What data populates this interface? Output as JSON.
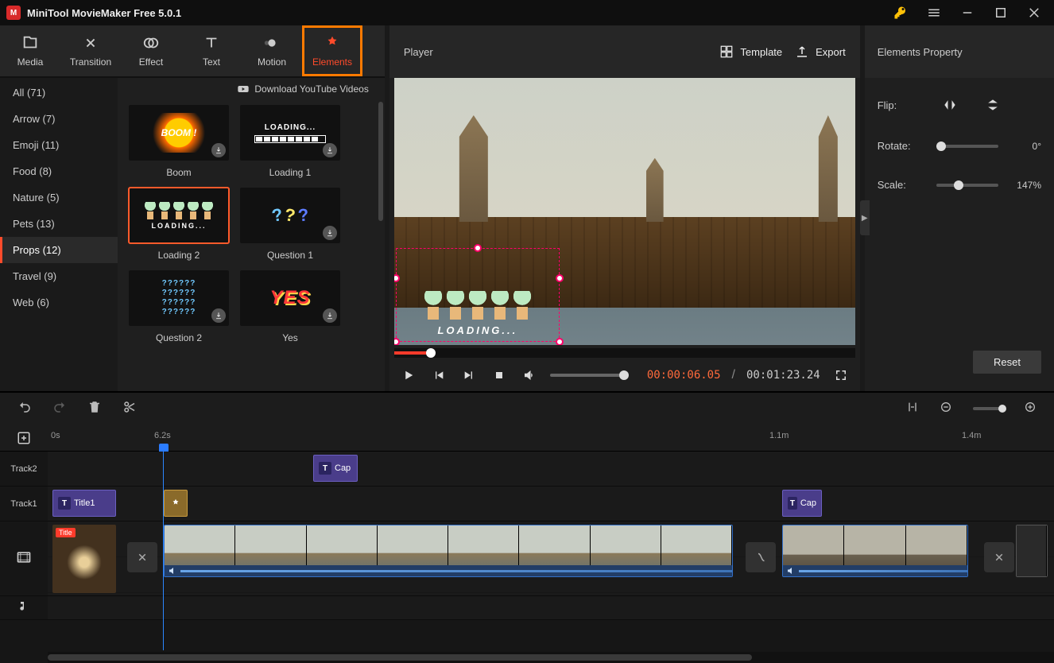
{
  "app_title": "MiniTool MovieMaker Free 5.0.1",
  "toolbar": {
    "media": "Media",
    "transition": "Transition",
    "effect": "Effect",
    "text": "Text",
    "motion": "Motion",
    "elements": "Elements"
  },
  "categories": [
    {
      "label": "All (71)"
    },
    {
      "label": "Arrow (7)"
    },
    {
      "label": "Emoji (11)"
    },
    {
      "label": "Food (8)"
    },
    {
      "label": "Nature (5)"
    },
    {
      "label": "Pets (13)"
    },
    {
      "label": "Props (12)",
      "active": true
    },
    {
      "label": "Travel (9)"
    },
    {
      "label": "Web (6)"
    }
  ],
  "download_yt": "Download YouTube Videos",
  "elements": [
    {
      "label": "Boom"
    },
    {
      "label": "Loading 1"
    },
    {
      "label": "Loading 2",
      "selected": true
    },
    {
      "label": "Question 1"
    },
    {
      "label": "Question 2"
    },
    {
      "label": "Yes"
    }
  ],
  "loading_art_text": "LOADING...",
  "player": {
    "title": "Player",
    "template": "Template",
    "export": "Export",
    "current_time": "00:00:06.05",
    "total_time": "00:01:23.24",
    "overlay_text": "LOADING..."
  },
  "props": {
    "title": "Elements Property",
    "flip": "Flip:",
    "rotate": "Rotate:",
    "rotate_val": "0°",
    "scale": "Scale:",
    "scale_val": "147%",
    "reset": "Reset"
  },
  "ruler": {
    "t0": "0s",
    "t1": "6.2s",
    "t2": "1.1m",
    "t3": "1.4m"
  },
  "tracks": {
    "track2": "Track2",
    "track1": "Track1",
    "clip_cap": "Cap",
    "clip_title1": "Title1",
    "clip_cap2": "Cap",
    "title_tag": "Title"
  },
  "question2_art": "??????\n??????\n??????\n??????"
}
